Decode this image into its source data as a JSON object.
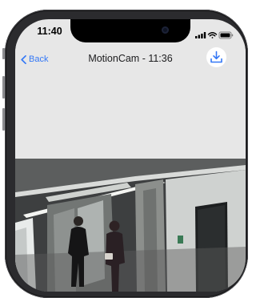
{
  "status_bar": {
    "time": "11:40"
  },
  "nav": {
    "back_label": "Back",
    "title": "MotionCam - 11:36"
  },
  "icons": {
    "back": "chevron-left-icon",
    "download": "download-icon",
    "signal": "cellular-signal-icon",
    "wifi": "wifi-icon",
    "battery": "battery-icon"
  },
  "colors": {
    "accent": "#3478f6",
    "screen_background": "#e7e7e7",
    "device_frame": "#2b2b2e"
  }
}
